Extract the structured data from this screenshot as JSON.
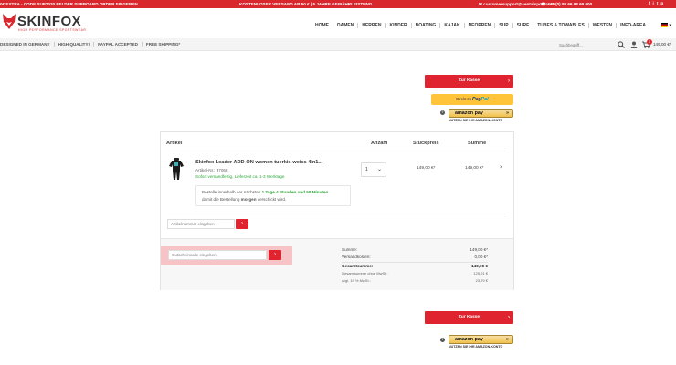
{
  "topbar": {
    "promo": "0€ EXTRA - CODE SUP2020 BEI DER SUPBOARD ORDER EINGEBEN",
    "center": "KOSTENLOSER VERSAND AB 50 € | 5 JAHRE GEWÄHRLEISTUNG",
    "email": "customersupport@sentalsport.com",
    "phone": "+49 (0) 80 66 98 69 000",
    "social": [
      "f",
      "i",
      "t",
      "p"
    ]
  },
  "header": {
    "brand": "SKINFOX",
    "tagline": "HIGH PERFORMANCE SPORTSWEAR",
    "nav": [
      "HOME",
      "DAMEN",
      "HERREN",
      "KINDER",
      "BOATING",
      "KAJAK",
      "NEOPREN",
      "SUP",
      "SURF",
      "TUBES & TOWABLES",
      "WESTEN",
      "INFO-AREA"
    ],
    "lang": "▾"
  },
  "subbar": {
    "usps": [
      "DESIGNED IN GERMANY",
      "HIGH QUALITY!",
      "PAYPAL ACCEPTED",
      "FREE SHIPPING*"
    ],
    "search_placeholder": "Suchbegriff...",
    "cart_count": "1",
    "cart_total": "149,00 €*"
  },
  "checkout": {
    "to_checkout_label": "Zur Kasse",
    "paypal_prefix": "Direkt zu",
    "paypal_brand_a": "Pay",
    "paypal_brand_b": "Pal",
    "amazon_label": "amazon pay",
    "amazon_sub": "NUTZEN SIE IHR AMAZON-KONTO",
    "help": "?"
  },
  "cart": {
    "headers": {
      "article": "Artikel",
      "quantity": "Anzahl",
      "unit_price": "Stückpreis",
      "sum": "Summe"
    },
    "item": {
      "name": "Skinfox Leader ADD-ON women tuerkis-weiss 4in1...",
      "sku": "Artikel-Nr.: 37068",
      "stock": "Sofort versandfertig, Lieferzeit ca. 1-3 Werktage",
      "qty": "1",
      "unit_price": "149,00 €*",
      "sum": "149,00 €*",
      "remove": "×"
    },
    "delivery": {
      "line1_a": "Bestelle innerhalb der nächsten ",
      "line1_b": "1 Tage 4 Stunden und 58 Minuten",
      "line2_a": "damit die Bestellung ",
      "line2_b": "morgen",
      "line2_c": " verschickt wird."
    },
    "article_number_placeholder": "Artikelnummer eingeben",
    "voucher_placeholder": "Gutscheincode eingeben",
    "go": "›",
    "totals": [
      {
        "label": "Summe:",
        "value": "149,00 €*"
      },
      {
        "label": "Versandkosten:",
        "value": "0,00 €*"
      },
      {
        "label": "Gesamtsumme:",
        "value": "149,00 €"
      },
      {
        "label": "Gesamtsumme ohne MwSt.:",
        "value": "125,21 €"
      },
      {
        "label": "zzgl. 19 % MwSt.:",
        "value": "23,79 €"
      }
    ]
  },
  "colors": {
    "brand_red": "#d9272e",
    "button_red": "#e0242f",
    "paypal_yellow": "#ffc439",
    "stock_green": "#2eaa3a"
  }
}
